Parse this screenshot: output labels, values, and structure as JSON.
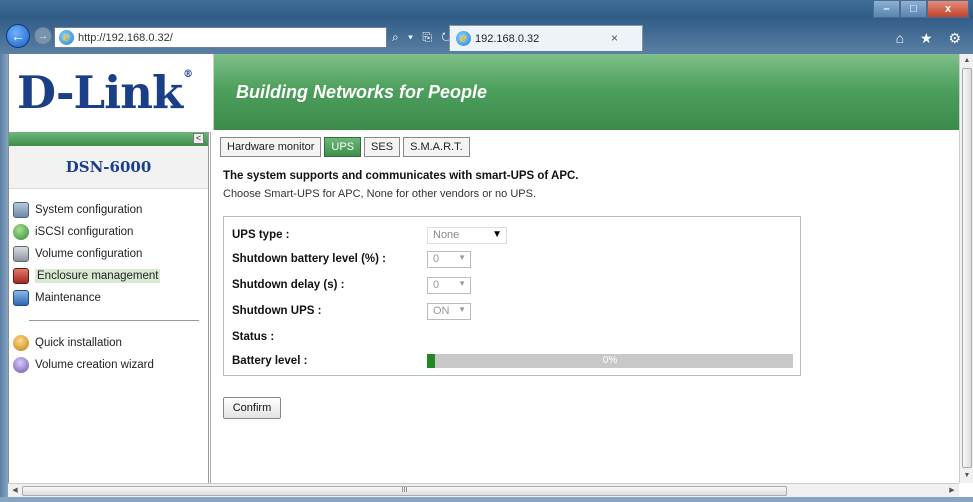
{
  "browser": {
    "address": "http://192.168.0.32/",
    "address_tools": "⌕ ▾ ⎘ ↻ ✕",
    "tab_title": "192.168.0.32",
    "tab_close": "×",
    "win_min": "–",
    "win_max": "□",
    "win_close": "x",
    "chrome_icons": "⌂ ★ ⚙"
  },
  "header": {
    "logo": "D-Link",
    "logo_mark": "®",
    "tagline": "Building Networks for People"
  },
  "sidebar": {
    "collapse": "<",
    "device": "DSN-6000",
    "items": [
      {
        "label": "System configuration",
        "icon": "system-config-icon"
      },
      {
        "label": "iSCSI configuration",
        "icon": "iscsi-globe-icon"
      },
      {
        "label": "Volume configuration",
        "icon": "volume-icon"
      },
      {
        "label": "Enclosure management",
        "icon": "enclosure-icon",
        "active": true
      },
      {
        "label": "Maintenance",
        "icon": "maintenance-icon"
      }
    ],
    "extra": [
      {
        "label": "Quick installation",
        "icon": "quick-install-icon"
      },
      {
        "label": "Volume creation wizard",
        "icon": "wizard-icon"
      }
    ]
  },
  "tabs": [
    {
      "label": "Hardware monitor"
    },
    {
      "label": "UPS",
      "active": true
    },
    {
      "label": "SES"
    },
    {
      "label": "S.M.A.R.T."
    }
  ],
  "content": {
    "desc_bold": "The system supports and communicates with smart-UPS of APC.",
    "desc": "Choose Smart-UPS for APC, None for other vendors or no UPS.",
    "fields": {
      "ups_type_label": "UPS type :",
      "ups_type_value": "None",
      "shutdown_battery_label": "Shutdown battery level (%) :",
      "shutdown_battery_value": "0",
      "shutdown_delay_label": "Shutdown delay (s) :",
      "shutdown_delay_value": "0",
      "shutdown_ups_label": "Shutdown UPS :",
      "shutdown_ups_value": "ON",
      "status_label": "Status :",
      "battery_label": "Battery level :",
      "battery_value": "0%",
      "battery_fraction": 0
    },
    "confirm": "Confirm"
  },
  "scrollbar": {
    "h_grip": "III",
    "up": "▲",
    "down": "▼",
    "left": "◀",
    "right": "▶"
  },
  "colors": {
    "brand_blue": "#1b3f86",
    "banner_green": "#4ea05d",
    "progress_green": "#1f8a1f"
  }
}
